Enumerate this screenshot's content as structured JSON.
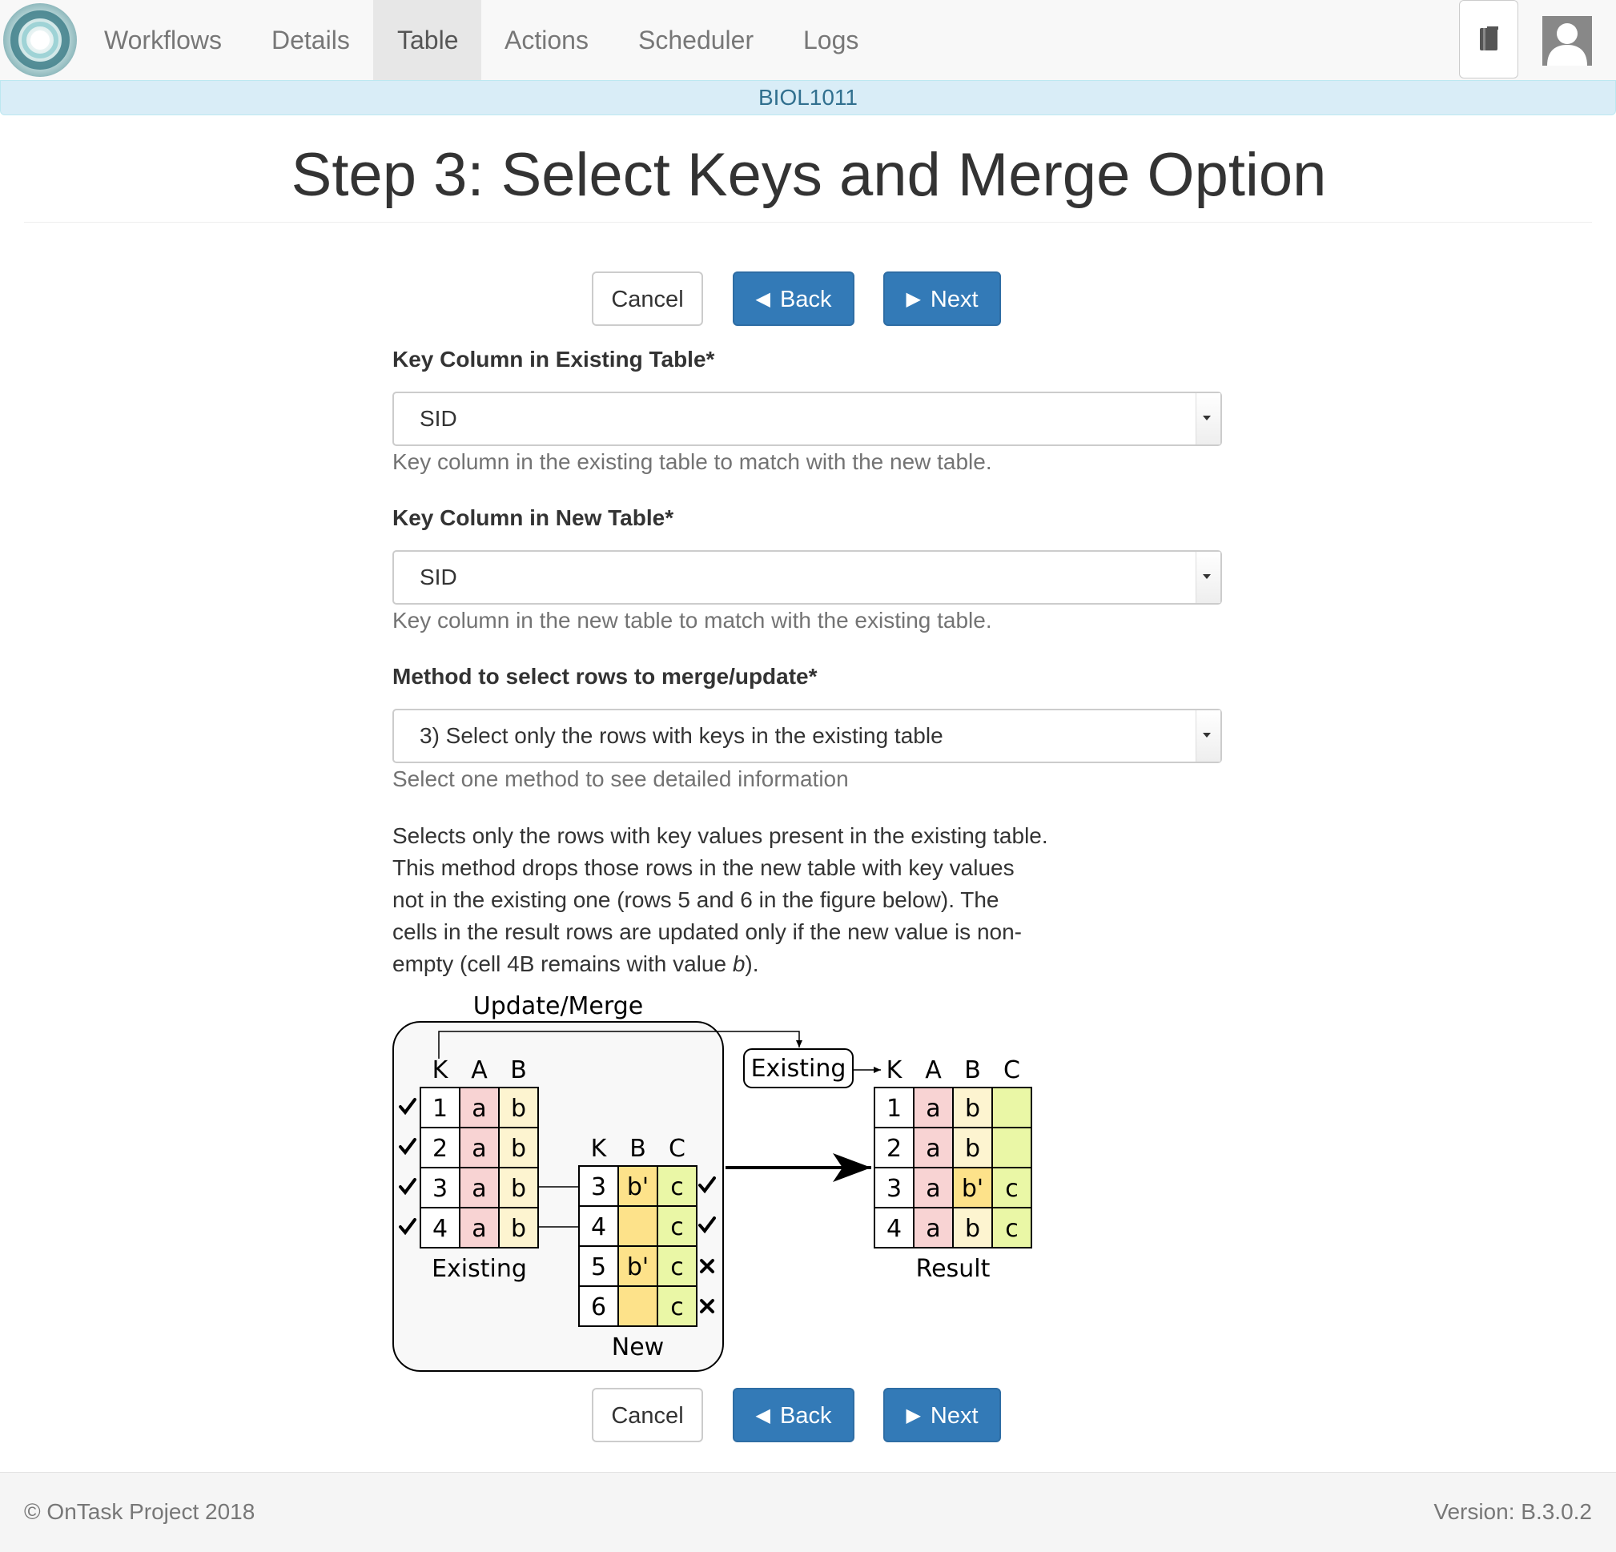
{
  "nav": {
    "items": [
      {
        "label": "Workflows",
        "active": false
      },
      {
        "label": "Details",
        "active": false
      },
      {
        "label": "Table",
        "active": true
      },
      {
        "label": "Actions",
        "active": false
      },
      {
        "label": "Scheduler",
        "active": false
      },
      {
        "label": "Logs",
        "active": false
      }
    ],
    "icons": [
      "ontask-logo-icon",
      "book-icon",
      "user-avatar-icon"
    ]
  },
  "course": "BIOL1011",
  "title": "Step 3: Select Keys and Merge Option",
  "buttons": {
    "cancel": "Cancel",
    "back": "Back",
    "next": "Next"
  },
  "form": {
    "existing_key": {
      "label": "Key Column in Existing Table*",
      "value": "SID",
      "help": "Key column in the existing table to match with the new table."
    },
    "new_key": {
      "label": "Key Column in New Table*",
      "value": "SID",
      "help": "Key column in the new table to match with the existing table."
    },
    "method": {
      "label": "Method to select rows to merge/update*",
      "value": "3) Select only the rows with keys in the existing table",
      "help": "Select one method to see detailed information"
    }
  },
  "description": {
    "text_before": "Selects only the rows with key values present in the existing table. This method drops those rows in the new table with key values not in the existing one (rows 5 and 6 in the figure below). The cells in the result rows are updated only if the new value is non-empty (cell 4B remains with value ",
    "emph": "b",
    "text_after": ")."
  },
  "figure": {
    "title": "Update/Merge",
    "existing_pointer_label": "Existing",
    "existing_table": {
      "caption": "Existing",
      "headers": [
        "K",
        "A",
        "B"
      ],
      "rows": [
        [
          "1",
          "a",
          "b"
        ],
        [
          "2",
          "a",
          "b"
        ],
        [
          "3",
          "a",
          "b"
        ],
        [
          "4",
          "a",
          "b"
        ]
      ]
    },
    "new_table": {
      "caption": "New",
      "headers": [
        "K",
        "B",
        "C"
      ],
      "rows": [
        [
          "3",
          "b'",
          "c"
        ],
        [
          "4",
          "",
          "c"
        ],
        [
          "5",
          "b'",
          "c"
        ],
        [
          "6",
          "",
          "c"
        ]
      ],
      "row_marks": [
        "check",
        "check",
        "cross",
        "cross"
      ]
    },
    "result_table": {
      "caption": "Result",
      "headers": [
        "K",
        "A",
        "B",
        "C"
      ],
      "rows": [
        [
          "1",
          "a",
          "b",
          ""
        ],
        [
          "2",
          "a",
          "b",
          ""
        ],
        [
          "3",
          "a",
          "b'",
          "c"
        ],
        [
          "4",
          "a",
          "b",
          "c"
        ]
      ]
    },
    "colors": {
      "a": "#f8d3d3",
      "b": "#fdf4d0",
      "b_prime": "#fde28a",
      "c": "#eaf7a6"
    }
  },
  "footer": {
    "copyright": "© OnTask Project 2018",
    "version": "Version: B.3.0.2"
  }
}
